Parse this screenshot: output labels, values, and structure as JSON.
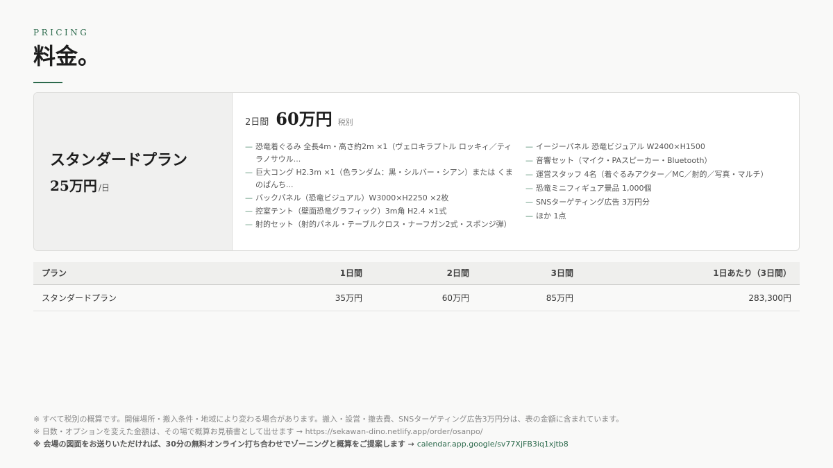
{
  "section": {
    "eyebrow": "PRICING",
    "title": "料金。"
  },
  "card": {
    "plan_name": "スタンダードプラン",
    "plan_price": "25万円",
    "plan_price_unit": "/日",
    "headline_days": "2日間",
    "headline_price": "60万円",
    "headline_tax": "税別",
    "features_left": [
      "恐竜着ぐるみ 全長4m・高さ約2m ×1（ヴェロキラプトル ロッキィ／ティラノサウル...",
      "巨大コング H2.3m ×1（色ランダム：黒・シルバー・シアン）または くまのぱんち...",
      "バックパネル（恐竜ビジュアル）W3000×H2250 ×2枚",
      "控室テント（壁面恐竜グラフィック）3m角 H2.4 ×1式",
      "射的セット（射的パネル・テーブルクロス・ナーフガン2式・スポンジ弾）"
    ],
    "features_right": [
      "イージーパネル 恐竜ビジュアル W2400×H1500",
      "音響セット（マイク・PAスピーカー・Bluetooth）",
      "運営スタッフ 4名（着ぐるみアクター／MC／射的／写真・マルチ）",
      "恐竜ミニフィギュア景品 1,000個",
      "SNSターゲティング広告 3万円分",
      "ほか 1点"
    ]
  },
  "table": {
    "headers": [
      "プラン",
      "1日間",
      "2日間",
      "3日間",
      "1日あたり（3日間）"
    ],
    "rows": [
      [
        "スタンダードプラン",
        "35万円",
        "60万円",
        "85万円",
        "283,300円"
      ]
    ]
  },
  "notes": {
    "line1": "※ すべて税別の概算です。開催場所・搬入条件・地域により変わる場合があります。搬入・設営・撤去費、SNSターゲティング広告3万円分は、表の金額に含まれています。",
    "line2": "※ 日数・オプションを変えた金額は、その場で概算お見積書として出せます → https://sekawan-dino.netlify.app/order/osanpo/",
    "line3_text": "※ 会場の図面をお送りいただければ、30分の無料オンライン打ち合わせでゾーニングと概算をご提案します →",
    "line3_link": "calendar.app.google/sv77XjFB3iq1xjtb8"
  },
  "colors": {
    "accent": "#2c6a4c",
    "background": "#f9f9f8",
    "card_left_bg": "#f0f0ef",
    "table_header_bg": "#efefed"
  }
}
